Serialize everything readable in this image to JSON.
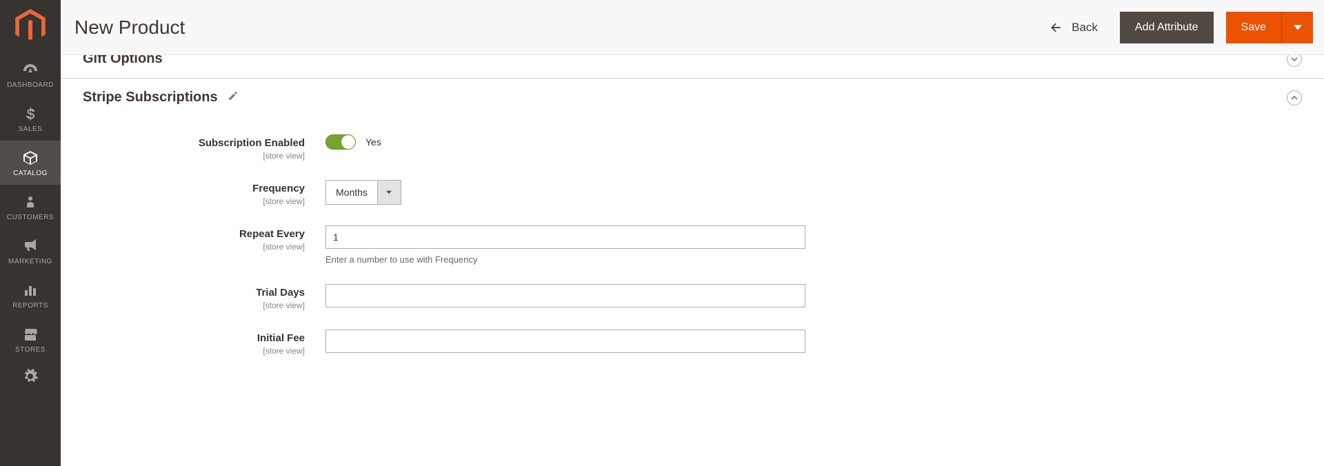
{
  "header": {
    "title": "New Product",
    "back_label": "Back",
    "add_attribute_label": "Add Attribute",
    "save_label": "Save"
  },
  "sidebar": {
    "items": [
      {
        "label": "DASHBOARD"
      },
      {
        "label": "SALES"
      },
      {
        "label": "CATALOG"
      },
      {
        "label": "CUSTOMERS"
      },
      {
        "label": "MARKETING"
      },
      {
        "label": "REPORTS"
      },
      {
        "label": "STORES"
      }
    ]
  },
  "sections": {
    "gift_options": {
      "title": "Gift Options"
    },
    "stripe": {
      "title": "Stripe Subscriptions",
      "fields": {
        "enabled": {
          "label": "Subscription Enabled",
          "scope": "[store view]",
          "value_text": "Yes"
        },
        "frequency": {
          "label": "Frequency",
          "scope": "[store view]",
          "selected": "Months"
        },
        "repeat_every": {
          "label": "Repeat Every",
          "scope": "[store view]",
          "value": "1",
          "note": "Enter a number to use with Frequency"
        },
        "trial_days": {
          "label": "Trial Days",
          "scope": "[store view]",
          "value": ""
        },
        "initial_fee": {
          "label": "Initial Fee",
          "scope": "[store view]",
          "value": ""
        }
      }
    }
  }
}
